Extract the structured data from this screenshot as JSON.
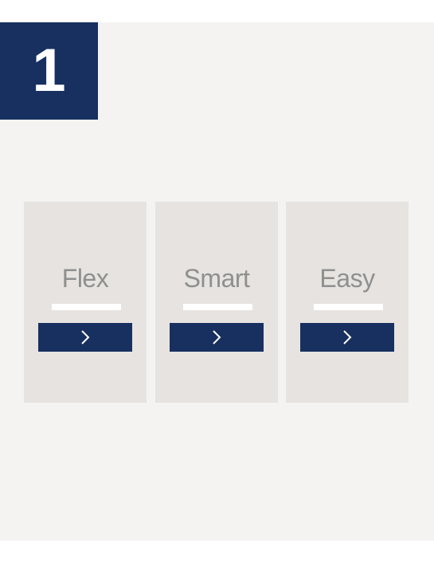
{
  "step": {
    "number": "1"
  },
  "cards": [
    {
      "title": "Flex",
      "button_icon": "chevron-right-icon"
    },
    {
      "title": "Smart",
      "button_icon": "chevron-right-icon"
    },
    {
      "title": "Easy",
      "button_icon": "chevron-right-icon"
    }
  ],
  "colors": {
    "badge_background": "#17305f",
    "button_background": "#17305f",
    "card_background": "#e6e3e0",
    "page_background": "#f4f3f1",
    "title_text": "#8f8f8f"
  }
}
